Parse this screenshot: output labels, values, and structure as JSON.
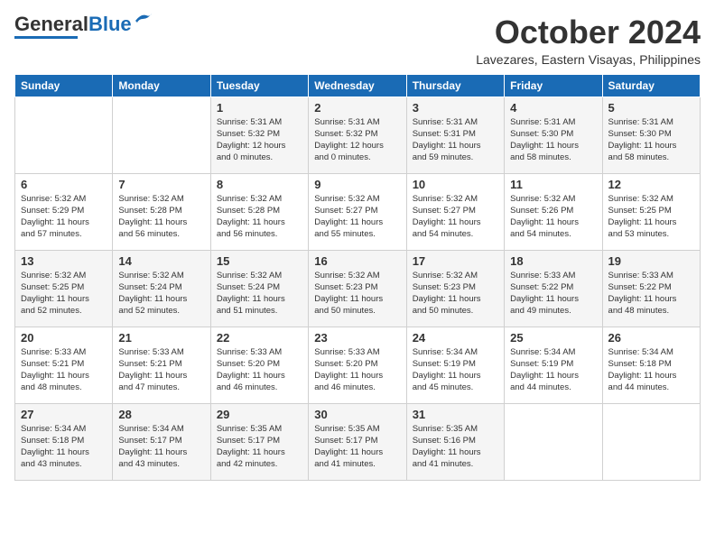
{
  "header": {
    "logo_general": "General",
    "logo_blue": "Blue",
    "month": "October 2024",
    "location": "Lavezares, Eastern Visayas, Philippines"
  },
  "weekdays": [
    "Sunday",
    "Monday",
    "Tuesday",
    "Wednesday",
    "Thursday",
    "Friday",
    "Saturday"
  ],
  "weeks": [
    [
      {
        "day": "",
        "info": ""
      },
      {
        "day": "",
        "info": ""
      },
      {
        "day": "1",
        "info": "Sunrise: 5:31 AM\nSunset: 5:32 PM\nDaylight: 12 hours\nand 0 minutes."
      },
      {
        "day": "2",
        "info": "Sunrise: 5:31 AM\nSunset: 5:32 PM\nDaylight: 12 hours\nand 0 minutes."
      },
      {
        "day": "3",
        "info": "Sunrise: 5:31 AM\nSunset: 5:31 PM\nDaylight: 11 hours\nand 59 minutes."
      },
      {
        "day": "4",
        "info": "Sunrise: 5:31 AM\nSunset: 5:30 PM\nDaylight: 11 hours\nand 58 minutes."
      },
      {
        "day": "5",
        "info": "Sunrise: 5:31 AM\nSunset: 5:30 PM\nDaylight: 11 hours\nand 58 minutes."
      }
    ],
    [
      {
        "day": "6",
        "info": "Sunrise: 5:32 AM\nSunset: 5:29 PM\nDaylight: 11 hours\nand 57 minutes."
      },
      {
        "day": "7",
        "info": "Sunrise: 5:32 AM\nSunset: 5:28 PM\nDaylight: 11 hours\nand 56 minutes."
      },
      {
        "day": "8",
        "info": "Sunrise: 5:32 AM\nSunset: 5:28 PM\nDaylight: 11 hours\nand 56 minutes."
      },
      {
        "day": "9",
        "info": "Sunrise: 5:32 AM\nSunset: 5:27 PM\nDaylight: 11 hours\nand 55 minutes."
      },
      {
        "day": "10",
        "info": "Sunrise: 5:32 AM\nSunset: 5:27 PM\nDaylight: 11 hours\nand 54 minutes."
      },
      {
        "day": "11",
        "info": "Sunrise: 5:32 AM\nSunset: 5:26 PM\nDaylight: 11 hours\nand 54 minutes."
      },
      {
        "day": "12",
        "info": "Sunrise: 5:32 AM\nSunset: 5:25 PM\nDaylight: 11 hours\nand 53 minutes."
      }
    ],
    [
      {
        "day": "13",
        "info": "Sunrise: 5:32 AM\nSunset: 5:25 PM\nDaylight: 11 hours\nand 52 minutes."
      },
      {
        "day": "14",
        "info": "Sunrise: 5:32 AM\nSunset: 5:24 PM\nDaylight: 11 hours\nand 52 minutes."
      },
      {
        "day": "15",
        "info": "Sunrise: 5:32 AM\nSunset: 5:24 PM\nDaylight: 11 hours\nand 51 minutes."
      },
      {
        "day": "16",
        "info": "Sunrise: 5:32 AM\nSunset: 5:23 PM\nDaylight: 11 hours\nand 50 minutes."
      },
      {
        "day": "17",
        "info": "Sunrise: 5:32 AM\nSunset: 5:23 PM\nDaylight: 11 hours\nand 50 minutes."
      },
      {
        "day": "18",
        "info": "Sunrise: 5:33 AM\nSunset: 5:22 PM\nDaylight: 11 hours\nand 49 minutes."
      },
      {
        "day": "19",
        "info": "Sunrise: 5:33 AM\nSunset: 5:22 PM\nDaylight: 11 hours\nand 48 minutes."
      }
    ],
    [
      {
        "day": "20",
        "info": "Sunrise: 5:33 AM\nSunset: 5:21 PM\nDaylight: 11 hours\nand 48 minutes."
      },
      {
        "day": "21",
        "info": "Sunrise: 5:33 AM\nSunset: 5:21 PM\nDaylight: 11 hours\nand 47 minutes."
      },
      {
        "day": "22",
        "info": "Sunrise: 5:33 AM\nSunset: 5:20 PM\nDaylight: 11 hours\nand 46 minutes."
      },
      {
        "day": "23",
        "info": "Sunrise: 5:33 AM\nSunset: 5:20 PM\nDaylight: 11 hours\nand 46 minutes."
      },
      {
        "day": "24",
        "info": "Sunrise: 5:34 AM\nSunset: 5:19 PM\nDaylight: 11 hours\nand 45 minutes."
      },
      {
        "day": "25",
        "info": "Sunrise: 5:34 AM\nSunset: 5:19 PM\nDaylight: 11 hours\nand 44 minutes."
      },
      {
        "day": "26",
        "info": "Sunrise: 5:34 AM\nSunset: 5:18 PM\nDaylight: 11 hours\nand 44 minutes."
      }
    ],
    [
      {
        "day": "27",
        "info": "Sunrise: 5:34 AM\nSunset: 5:18 PM\nDaylight: 11 hours\nand 43 minutes."
      },
      {
        "day": "28",
        "info": "Sunrise: 5:34 AM\nSunset: 5:17 PM\nDaylight: 11 hours\nand 43 minutes."
      },
      {
        "day": "29",
        "info": "Sunrise: 5:35 AM\nSunset: 5:17 PM\nDaylight: 11 hours\nand 42 minutes."
      },
      {
        "day": "30",
        "info": "Sunrise: 5:35 AM\nSunset: 5:17 PM\nDaylight: 11 hours\nand 41 minutes."
      },
      {
        "day": "31",
        "info": "Sunrise: 5:35 AM\nSunset: 5:16 PM\nDaylight: 11 hours\nand 41 minutes."
      },
      {
        "day": "",
        "info": ""
      },
      {
        "day": "",
        "info": ""
      }
    ]
  ]
}
